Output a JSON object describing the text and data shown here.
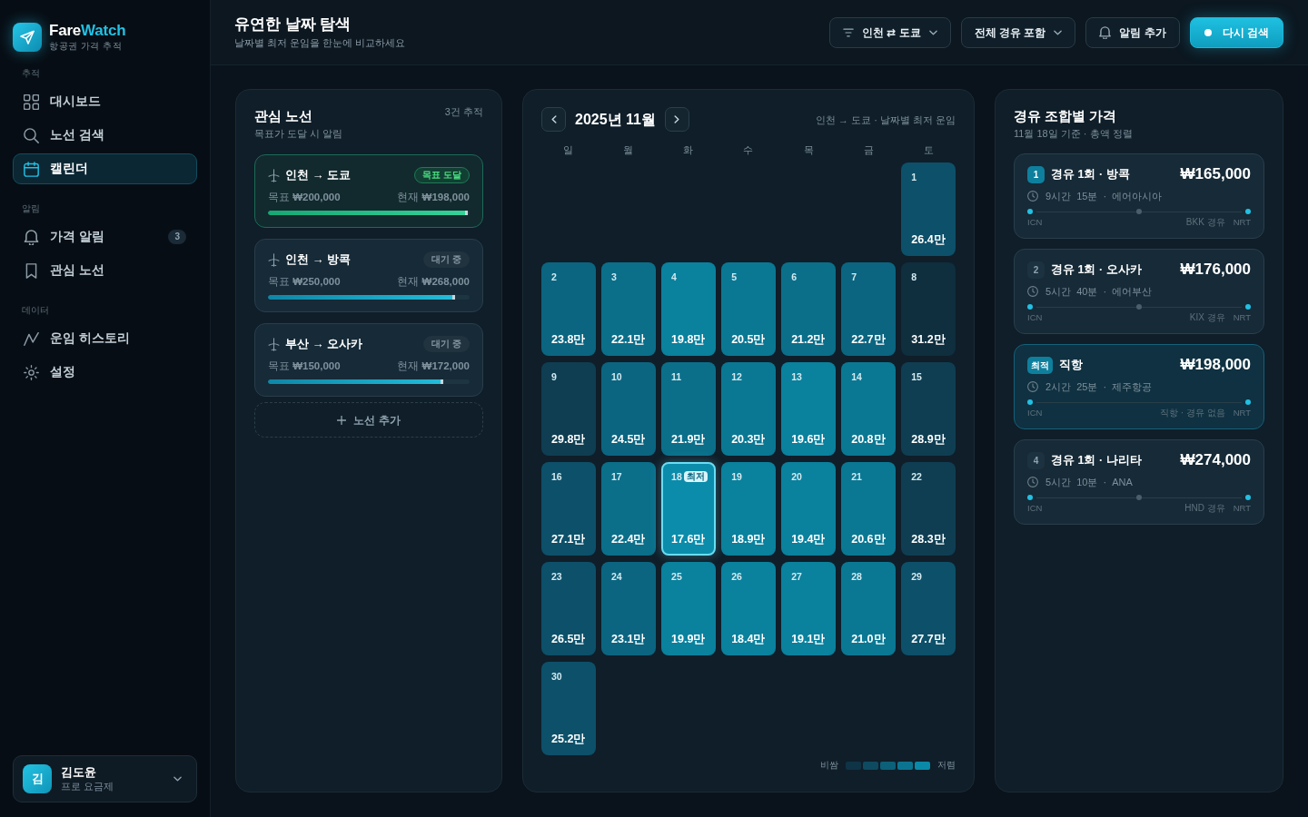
{
  "sidebar": {
    "brand": {
      "name_start": "Fare",
      "name_end": "Watch",
      "tagline": "항공권 가격 추적"
    },
    "sections": [
      {
        "label": "추적",
        "items": [
          {
            "kind": "dashboard",
            "label": "대시보드",
            "selected": false
          },
          {
            "kind": "search",
            "label": "노선 검색",
            "selected": false
          },
          {
            "kind": "calendar",
            "label": "캘린더",
            "selected": true
          }
        ]
      },
      {
        "label": "알림",
        "items": [
          {
            "kind": "alert",
            "label": "가격 알림",
            "badge": "3",
            "selected": false
          },
          {
            "kind": "bookmark",
            "label": "관심 노선",
            "selected": false
          }
        ]
      },
      {
        "label": "데이터",
        "items": [
          {
            "kind": "history",
            "label": "운임 히스토리",
            "selected": false
          },
          {
            "kind": "settings",
            "label": "설정",
            "selected": false
          }
        ]
      }
    ],
    "user": {
      "initial": "김",
      "name": "김도윤",
      "plan": "프로 요금제"
    }
  },
  "header": {
    "title": "유연한 날짜 탐색",
    "subtitle": "날짜별 최저 운임을 한눈에 비교하세요",
    "route_picker": "인천 ⇄ 도쿄",
    "stops_filter": "전체 경유 포함",
    "alert_button": "알림 추가",
    "search_button": "다시 검색"
  },
  "watchlist": {
    "title": "관심 노선",
    "subtitle": "목표가 도달 시 알림",
    "count": "3건 추적",
    "routes": [
      {
        "route": "인천 → 도쿄",
        "status": "목표 도달",
        "reached": true,
        "target": "목표 **₩200,000**",
        "current": "현재 **₩198,000**",
        "level": 0.99
      },
      {
        "route": "인천 → 방콕",
        "status": "대기 중",
        "reached": false,
        "target": "목표 **₩250,000**",
        "current": "현재 **₩268,000**",
        "level": 0.93
      },
      {
        "route": "부산 → 오사카",
        "status": "대기 중",
        "reached": false,
        "target": "목표 **₩150,000**",
        "current": "현재 **₩172,000**",
        "level": 0.87
      }
    ],
    "add_button": "노선 추가"
  },
  "calendar": {
    "month": "2025년 11월",
    "caption": "인천 → 도쿄 · 날짜별 최저 운임",
    "weekdays": [
      "일",
      "월",
      "화",
      "수",
      "목",
      "금",
      "토"
    ],
    "weeks": [
      {
        "days": [
          {
            "day": "1",
            "price": "26.4만",
            "color": "#0d5069",
            "selected": false
          }
        ]
      },
      {
        "days": [
          {
            "day": "2",
            "price": "23.8만",
            "color": "#0b6580",
            "selected": false
          },
          {
            "day": "3",
            "price": "22.1만",
            "color": "#0b6f8a",
            "selected": false
          },
          {
            "day": "4",
            "price": "19.8만",
            "color": "#0a819d",
            "selected": false
          },
          {
            "day": "5",
            "price": "20.5만",
            "color": "#0a7893",
            "selected": false
          },
          {
            "day": "6",
            "price": "21.2만",
            "color": "#0b6f8a",
            "selected": false
          },
          {
            "day": "7",
            "price": "22.7만",
            "color": "#0b6580",
            "selected": false
          },
          {
            "day": "8",
            "price": "31.2만",
            "color": "#0f2e3e",
            "selected": false
          }
        ]
      },
      {
        "days": [
          {
            "day": "9",
            "price": "29.8만",
            "color": "#0f3e52",
            "selected": false
          },
          {
            "day": "10",
            "price": "24.5만",
            "color": "#0b6580",
            "selected": false
          },
          {
            "day": "11",
            "price": "21.9만",
            "color": "#0b6f8a",
            "selected": false
          },
          {
            "day": "12",
            "price": "20.3만",
            "color": "#0a7893",
            "selected": false
          },
          {
            "day": "13",
            "price": "19.6만",
            "color": "#0a819d",
            "selected": false
          },
          {
            "day": "14",
            "price": "20.8만",
            "color": "#0a7893",
            "selected": false
          },
          {
            "day": "15",
            "price": "28.9만",
            "color": "#0f3e52",
            "selected": false
          }
        ]
      },
      {
        "days": [
          {
            "day": "16",
            "price": "27.1만",
            "color": "#0d5069",
            "selected": false
          },
          {
            "day": "17",
            "price": "22.4만",
            "color": "#0b6f8a",
            "selected": false
          },
          {
            "day": "18",
            "price": "17.6만",
            "color": "#0b8cab",
            "selected": true,
            "badge": "최저"
          },
          {
            "day": "19",
            "price": "18.9만",
            "color": "#0a819d",
            "selected": false
          },
          {
            "day": "20",
            "price": "19.4만",
            "color": "#0a819d",
            "selected": false
          },
          {
            "day": "21",
            "price": "20.6만",
            "color": "#0a7893",
            "selected": false
          },
          {
            "day": "22",
            "price": "28.3만",
            "color": "#0f3e52",
            "selected": false
          }
        ]
      },
      {
        "days": [
          {
            "day": "23",
            "price": "26.5만",
            "color": "#0d5069",
            "selected": false
          },
          {
            "day": "24",
            "price": "23.1만",
            "color": "#0b6580",
            "selected": false
          },
          {
            "day": "25",
            "price": "19.9만",
            "color": "#0a819d",
            "selected": false
          },
          {
            "day": "26",
            "price": "18.4만",
            "color": "#0a819d",
            "selected": false
          },
          {
            "day": "27",
            "price": "19.1만",
            "color": "#0a819d",
            "selected": false
          },
          {
            "day": "28",
            "price": "21.0만",
            "color": "#0a7893",
            "selected": false
          },
          {
            "day": "29",
            "price": "27.7만",
            "color": "#0d5069",
            "selected": false
          }
        ]
      },
      {
        "days": [
          {
            "day": "30",
            "price": "25.2만",
            "color": "#0d5069",
            "selected": false
          }
        ]
      }
    ],
    "legend": {
      "high": "비쌈",
      "low": "저렴",
      "swatches": [
        {
          "color": "#0f3446"
        },
        {
          "color": "#0e4b61"
        },
        {
          "color": "#0c6079"
        },
        {
          "color": "#0b7591"
        },
        {
          "color": "#0a8aa8"
        }
      ]
    }
  },
  "layovers": {
    "title": "경유 조합별 가격",
    "subtitle": "11월 18일 기준 · 총액 정렬",
    "options": [
      {
        "rank": "1",
        "rank_accent": true,
        "title": "경유 1회 · 방콕",
        "price": "₩165,000",
        "details": "9시간 15분 · 에어아시아",
        "kind": "layover",
        "origin": "ICN",
        "via": "BKK 경유",
        "destination": "NRT",
        "selected": false
      },
      {
        "rank": "2",
        "rank_accent": false,
        "title": "경유 1회 · 오사카",
        "price": "₩176,000",
        "details": "5시간 40분 · 에어부산",
        "kind": "layover",
        "origin": "ICN",
        "via": "KIX 경유",
        "destination": "NRT",
        "selected": false
      },
      {
        "rank": "최적",
        "rank_accent": true,
        "title": "직항",
        "price": "₩198,000",
        "details": "2시간 25분 · 제주항공",
        "kind": "direct",
        "origin": "ICN",
        "via": "직항 · 경유 없음",
        "destination": "NRT",
        "selected": true
      },
      {
        "rank": "4",
        "rank_accent": false,
        "title": "경유 1회 · 나리타",
        "price": "₩274,000",
        "details": "5시간 10분 · ANA",
        "kind": "layover",
        "origin": "ICN",
        "via": "HND 경유",
        "destination": "NRT",
        "selected": false
      }
    ]
  }
}
